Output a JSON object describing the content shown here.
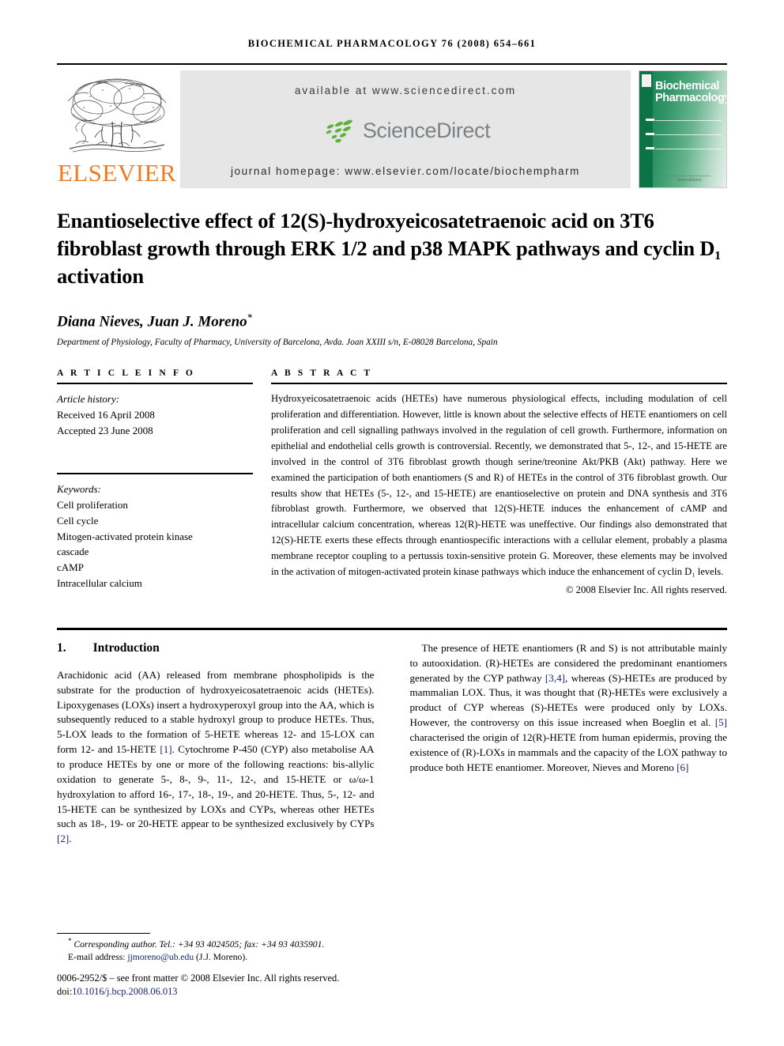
{
  "running_head": "BIOCHEMICAL PHARMACOLOGY 76 (2008) 654–661",
  "masthead": {
    "publisher_name": "ELSEVIER",
    "available_at": "available at www.sciencedirect.com",
    "sciencedirect_word": "ScienceDirect",
    "journal_homepage": "journal homepage: www.elsevier.com/locate/biochempharm",
    "cover": {
      "title_line1": "Biochemical",
      "title_line2": "Pharmacology",
      "footer_brand": "ScienceDirect"
    },
    "colors": {
      "elsevier_orange": "#F07C22",
      "sciencedirect_gray": "#7B8385",
      "sciencedirect_green": "#5CB335",
      "cover_green": "#0C7347",
      "masthead_band": "#E6E6E6"
    }
  },
  "article": {
    "title": "Enantioselective effect of 12(S)-hydroxyeicosatetraenoic acid on 3T6 fibroblast growth through ERK 1/2 and p38 MAPK pathways and cyclin D₁ activation",
    "authors": "Diana Nieves, Juan J. Moreno",
    "corresponding_marker": "*",
    "affiliation": "Department of Physiology, Faculty of Pharmacy, University of Barcelona, Avda. Joan XXIII s/n, E-08028 Barcelona, Spain"
  },
  "article_info": {
    "heading": "A R T I C L E    I N F O",
    "history_label": "Article history:",
    "received": "Received 16 April 2008",
    "accepted": "Accepted 23 June 2008",
    "keywords_label": "Keywords:",
    "keywords": [
      "Cell proliferation",
      "Cell cycle",
      "Mitogen-activated protein kinase",
      "cascade",
      "cAMP",
      "Intracellular calcium"
    ]
  },
  "abstract": {
    "heading": "A B S T R A C T",
    "text": "Hydroxyeicosatetraenoic acids (HETEs) have numerous physiological effects, including modulation of cell proliferation and differentiation. However, little is known about the selective effects of HETE enantiomers on cell proliferation and cell signalling pathways involved in the regulation of cell growth. Furthermore, information on epithelial and endothelial cells growth is controversial. Recently, we demonstrated that 5-, 12-, and 15-HETE are involved in the control of 3T6 fibroblast growth though serine/treonine Akt/PKB (Akt) pathway. Here we examined the participation of both enantiomers (S and R) of HETEs in the control of 3T6 fibroblast growth. Our results show that HETEs (5-, 12-, and 15-HETE) are enantioselective on protein and DNA synthesis and 3T6 fibroblast growth. Furthermore, we observed that 12(S)-HETE induces the enhancement of cAMP and intracellular calcium concentration, whereas 12(R)-HETE was uneffective. Our findings also demonstrated that 12(S)-HETE exerts these effects through enantiospecific interactions with a cellular element, probably a plasma membrane receptor coupling to a pertussis toxin-sensitive protein G. Moreover, these elements may be involved in the activation of mitogen-activated protein kinase pathways which induce the enhancement of cyclin D₁ levels.",
    "copyright": "© 2008 Elsevier Inc. All rights reserved."
  },
  "introduction": {
    "number": "1.",
    "heading": "Introduction",
    "left_p1_a": "Arachidonic acid (AA) released from membrane phospholipids is the substrate for the production of hydroxyeicosatetraenoic acids (HETEs). Lipoxygenases (LOXs) insert a hydroxyperoxyl group into the AA, which is subsequently reduced to a stable hydroxyl group to produce HETEs. Thus, 5-LOX leads to the formation of 5-HETE whereas 12- and 15-LOX can form 12- and 15-HETE ",
    "ref1": "[1]",
    "left_p1_b": ". Cytochrome P-450 (CYP) also metabolise AA to produce HETEs by one or more of the following reactions: bis-allylic oxidation to generate 5-, 8-, 9-, 11-, 12-, and 15-HETE or ω/ω-1 hydroxylation to afford 16-, 17-, 18-, 19-, and 20-HETE. Thus, 5-, 12- and 15-HETE can be synthesized by LOXs and CYPs, whereas other HETEs such as 18-, 19- or 20-HETE appear to be synthesized exclusively by CYPs ",
    "ref2": "[2]",
    "right_p1_end": ".",
    "right_p2_a": "The presence of HETE enantiomers (R and S) is not attributable mainly to autooxidation. (R)-HETEs are considered the predominant enantiomers generated by the CYP pathway ",
    "ref34": "[3,4]",
    "right_p2_b": ", whereas (S)-HETEs are produced by mammalian LOX. Thus, it was thought that (R)-HETEs were exclusively a product of CYP whereas (S)-HETEs were produced only by LOXs. However, the controversy on this issue increased when Boeglin et al. ",
    "ref5": "[5]",
    "right_p2_c": " characterised the origin of 12(R)-HETE from human epidermis, proving the existence of (R)-LOXs in mammals and the capacity of the LOX pathway to produce both HETE enantiomer. Moreover, Nieves and Moreno ",
    "ref6": "[6]"
  },
  "footnote": {
    "marker": "*",
    "corresponding": "Corresponding author. Tel.: +34 93 4024505; fax: +34 93 4035901.",
    "email_label": "E-mail address:",
    "email": "jjmoreno@ub.edu",
    "email_suffix": "(J.J. Moreno).",
    "issn_line": "0006-2952/$ – see front matter © 2008 Elsevier Inc. All rights reserved.",
    "doi_label": "doi:",
    "doi": "10.1016/j.bcp.2008.06.013"
  }
}
